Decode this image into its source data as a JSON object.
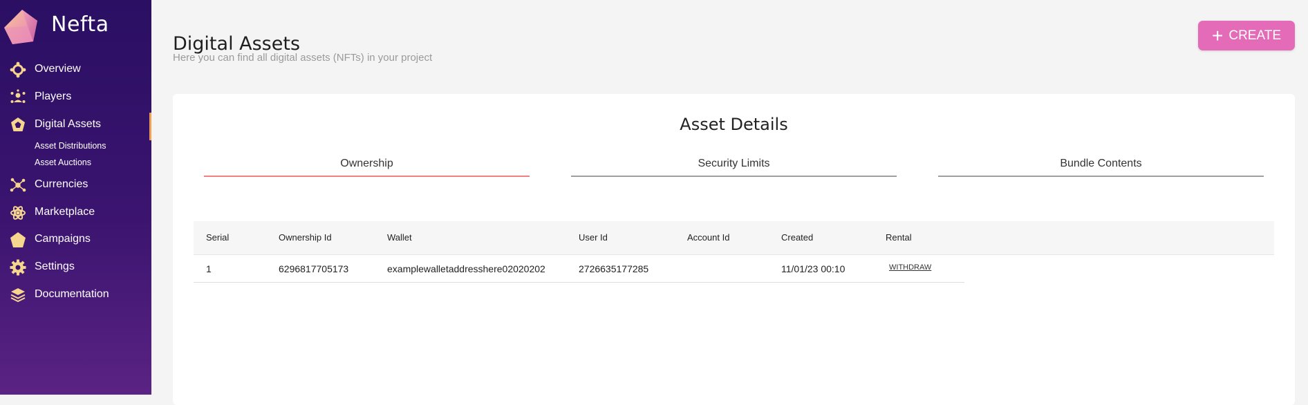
{
  "brand": {
    "name": "Nefta"
  },
  "sidebar": {
    "items": [
      {
        "label": "Overview",
        "icon": "overview-icon"
      },
      {
        "label": "Players",
        "icon": "players-icon"
      },
      {
        "label": "Digital Assets",
        "icon": "digital-assets-icon",
        "active": true
      },
      {
        "label": "Currencies",
        "icon": "currencies-icon"
      },
      {
        "label": "Marketplace",
        "icon": "marketplace-icon"
      },
      {
        "label": "Campaigns",
        "icon": "campaigns-icon"
      },
      {
        "label": "Settings",
        "icon": "settings-icon"
      },
      {
        "label": "Documentation",
        "icon": "documentation-icon"
      }
    ],
    "subitems": [
      {
        "label": "Asset Distributions"
      },
      {
        "label": "Asset Auctions"
      }
    ]
  },
  "header": {
    "title": "Digital Assets",
    "subtitle": "Here you can find all digital assets (NFTs) in your project",
    "create_label": "CREATE"
  },
  "card": {
    "title": "Asset Details",
    "tabs": [
      {
        "label": "Ownership",
        "active": true
      },
      {
        "label": "Security Limits",
        "active": false
      },
      {
        "label": "Bundle Contents",
        "active": false
      }
    ]
  },
  "table": {
    "columns": [
      "Serial",
      "Ownership Id",
      "Wallet",
      "User Id",
      "Account Id",
      "Created",
      "Rental"
    ],
    "rows": [
      {
        "serial": "1",
        "ownership_id": "6296817705173",
        "wallet": "examplewalletaddresshere02020202",
        "user_id": "2726635177285",
        "account_id": "",
        "created": "11/01/23 00:10",
        "rental_action": "WITHDRAW"
      }
    ]
  },
  "colors": {
    "sidebar_top": "#2a0f63",
    "sidebar_bottom": "#5a2384",
    "accent_pink": "#e36bb7",
    "tab_active": "#f08080",
    "icon_gold": "#f6d58e"
  }
}
